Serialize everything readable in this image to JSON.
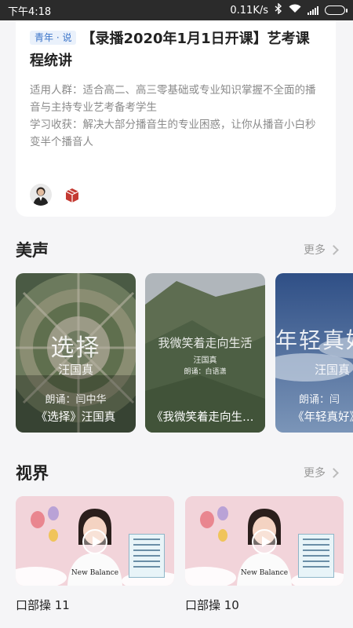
{
  "status_bar": {
    "time": "下午4:18",
    "net_speed": "0.11K/s",
    "bluetooth_icon": "bluetooth-icon",
    "wifi_icon": "wifi-icon",
    "signal_icon": "signal-icon",
    "battery_icon": "battery-icon"
  },
  "course": {
    "tag": "青年 · 说",
    "title": "【录播2020年1月1日开课】艺考课程统讲",
    "audience_label": "适用人群：",
    "audience": "适合高二、高三零基础或专业知识掌握不全面的播音与主持专业艺考备考学生",
    "gain_label": "学习收获：",
    "gain": "解决大部分播音生的专业困惑，让你从播音小白秒变半个播音人"
  },
  "sections": {
    "voice": {
      "title": "美声",
      "more": "更多"
    },
    "vision": {
      "title": "视界",
      "more": "更多"
    }
  },
  "voice_cards": [
    {
      "big": "选择",
      "sub": "汪国真",
      "reader": "朗诵：闫中华",
      "caption": "《选择》汪国真"
    },
    {
      "big": "我微笑着走向生活",
      "sub": "汪国真",
      "reader": "朗诵：白语潇",
      "caption": "《我微笑着走向生活》"
    },
    {
      "big": "年轻真好",
      "sub": "汪国真",
      "reader": "朗诵：闫",
      "caption": "《年轻真好》"
    }
  ],
  "video_cards": [
    {
      "title": "口部操 11",
      "shirt": "New Balance"
    },
    {
      "title": "口部操 10",
      "shirt": "New Balance"
    }
  ],
  "colors": {
    "accent_tag": "#3b74c9",
    "card_bg": "#ffffff",
    "page_bg": "#f5f5f7"
  }
}
